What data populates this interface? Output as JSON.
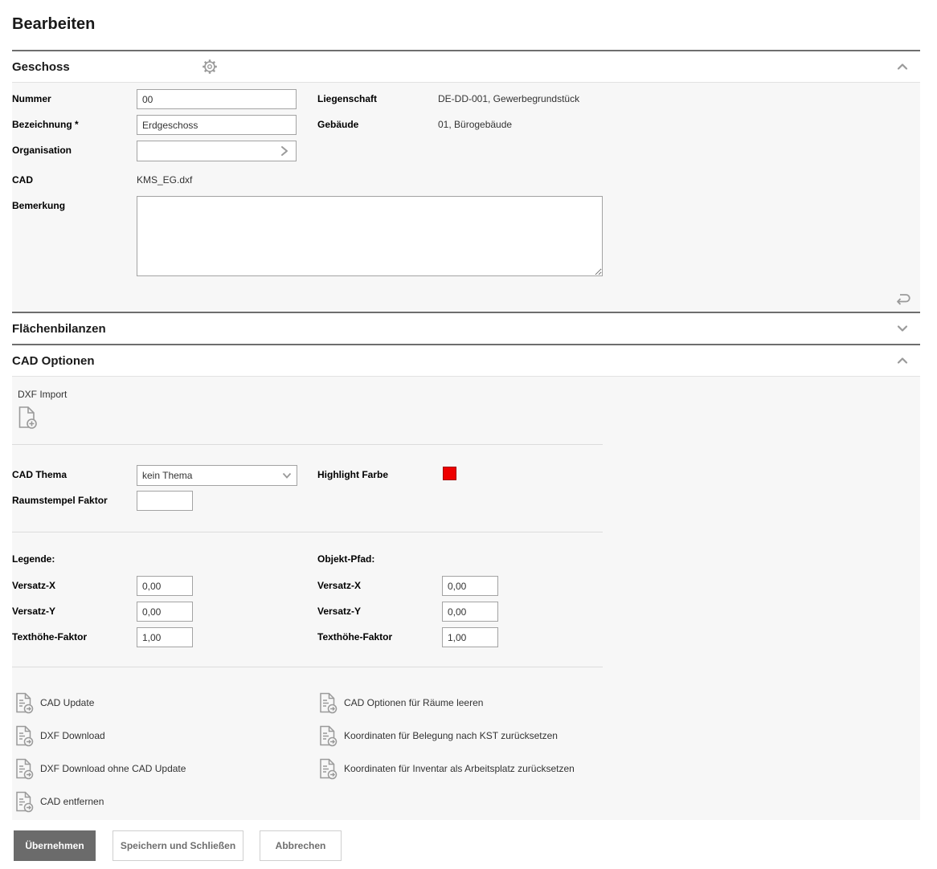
{
  "page": {
    "title": "Bearbeiten"
  },
  "sections": {
    "geschoss": {
      "title": "Geschoss",
      "fields": {
        "nummer": {
          "label": "Nummer",
          "value": "00"
        },
        "liegenschaft": {
          "label": "Liegenschaft",
          "value": "DE-DD-001, Gewerbegrundstück"
        },
        "bezeichnung": {
          "label": "Bezeichnung *",
          "value": "Erdgeschoss"
        },
        "gebaeude": {
          "label": "Gebäude",
          "value": "01, Bürogebäude"
        },
        "organisation": {
          "label": "Organisation",
          "value": ""
        },
        "cad": {
          "label": "CAD",
          "value": "KMS_EG.dxf"
        },
        "bemerkung": {
          "label": "Bemerkung",
          "value": ""
        }
      }
    },
    "flaechenbilanzen": {
      "title": "Flächenbilanzen"
    },
    "cad_optionen": {
      "title": "CAD Optionen",
      "dxf_import_label": "DXF Import",
      "cad_thema": {
        "label": "CAD Thema",
        "value": "kein Thema"
      },
      "highlight_farbe": {
        "label": "Highlight Farbe",
        "color": "#ee0000"
      },
      "raumstempel_faktor": {
        "label": "Raumstempel Faktor",
        "value": ""
      },
      "legende": {
        "title": "Legende:",
        "versatz_x": {
          "label": "Versatz-X",
          "value": "0,00"
        },
        "versatz_y": {
          "label": "Versatz-Y",
          "value": "0,00"
        },
        "texthoehe_faktor": {
          "label": "Texthöhe-Faktor",
          "value": "1,00"
        }
      },
      "objekt_pfad": {
        "title": "Objekt-Pfad:",
        "versatz_x": {
          "label": "Versatz-X",
          "value": "0,00"
        },
        "versatz_y": {
          "label": "Versatz-Y",
          "value": "0,00"
        },
        "texthoehe_faktor": {
          "label": "Texthöhe-Faktor",
          "value": "1,00"
        }
      },
      "actions_left": [
        "CAD Update",
        "DXF Download",
        "DXF Download ohne CAD Update",
        "CAD entfernen"
      ],
      "actions_right": [
        "CAD Optionen für Räume leeren",
        "Koordinaten für Belegung nach KST zurücksetzen",
        "Koordinaten für Inventar als Arbeitsplatz zurücksetzen"
      ]
    }
  },
  "footer": {
    "apply_label": "Übernehmen",
    "save_close_label": "Speichern und Schließen",
    "cancel_label": "Abbrechen"
  },
  "colors": {
    "section_border": "#6e6e6e",
    "panel_body_bg": "#f7f7f7",
    "primary_button_bg": "#6b6b6b",
    "highlight_color": "#ee0000"
  },
  "icons": {
    "settings": "gear-icon",
    "collapse": "chevron-up-icon",
    "expand": "chevron-down-icon",
    "undo": "undo-arrow-icon",
    "dxf_import": "file-plus-icon",
    "cad_action": "file-export-icon",
    "organisation_lookup": "chevron-right-icon"
  }
}
